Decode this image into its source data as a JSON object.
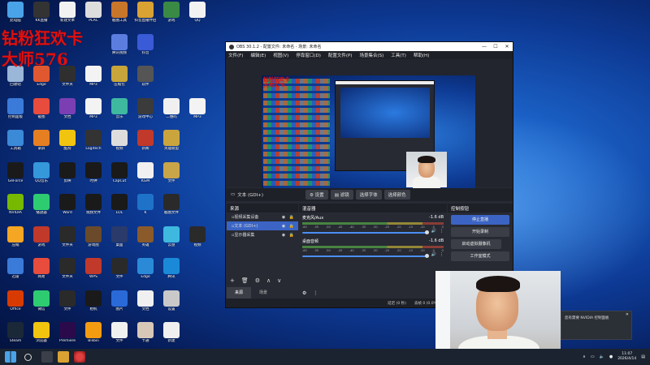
{
  "desktop": {
    "overlay_line1": "钻粉狂欢卡",
    "overlay_line2": "大师576",
    "icons": [
      {
        "label": "此电脑",
        "color": "#4aa3e8",
        "col": 0,
        "row": 0
      },
      {
        "label": "KK直播",
        "color": "#333",
        "col": 1,
        "row": 0
      },
      {
        "label": "新建文本",
        "color": "#f2f2f2",
        "col": 2,
        "row": 0
      },
      {
        "label": "PLAC",
        "color": "#ddd",
        "col": 3,
        "row": 0
      },
      {
        "label": "截图工具",
        "color": "#c8762a",
        "col": 4,
        "row": 0
      },
      {
        "label": "抖音直播伴侣",
        "color": "#d9a232",
        "col": 5,
        "row": 0
      },
      {
        "label": "游戏",
        "color": "#3a8a45",
        "col": 6,
        "row": 0
      },
      {
        "label": "QQ",
        "color": "#f2f2f2",
        "col": 7,
        "row": 0
      },
      {
        "label": "腾讯视频",
        "color": "#5c7de0",
        "col": 4,
        "row": 1
      },
      {
        "label": "抖音",
        "color": "#3a5ad8",
        "col": 5,
        "row": 1
      },
      {
        "label": "压缩包",
        "color": "#c7a53a",
        "col": 4,
        "row": 2
      },
      {
        "label": "软件",
        "color": "#555",
        "col": 5,
        "row": 2
      },
      {
        "label": "回收站",
        "color": "#9ab6d8",
        "col": 0,
        "row": 2
      },
      {
        "label": "Edge",
        "color": "#e05830",
        "col": 1,
        "row": 2
      },
      {
        "label": "文件夹",
        "color": "#2f2f2f",
        "col": 2,
        "row": 2
      },
      {
        "label": "MP3",
        "color": "#f3f3f3",
        "col": 3,
        "row": 2
      },
      {
        "label": "音乐",
        "color": "#3fb8a0",
        "col": 4,
        "row": 3
      },
      {
        "label": "游戏中心",
        "color": "#3b3b3b",
        "col": 5,
        "row": 3
      },
      {
        "label": "二维码",
        "color": "#f0f0f0",
        "col": 6,
        "row": 3
      },
      {
        "label": "MP3",
        "color": "#f3f3f3",
        "col": 7,
        "row": 3
      },
      {
        "label": "控制面板",
        "color": "#3a7ad8",
        "col": 0,
        "row": 3
      },
      {
        "label": "截图",
        "color": "#e74c3c",
        "col": 1,
        "row": 3
      },
      {
        "label": "文档",
        "color": "#7b3fb3",
        "col": 2,
        "row": 3
      },
      {
        "label": "MP3",
        "color": "#f3f3f3",
        "col": 3,
        "row": 3
      },
      {
        "label": "工具箱",
        "color": "#3a8ad8",
        "col": 0,
        "row": 4
      },
      {
        "label": "录屏",
        "color": "#e67e22",
        "col": 1,
        "row": 4
      },
      {
        "label": "酷狗",
        "color": "#f1c40f",
        "col": 2,
        "row": 4
      },
      {
        "label": "Logitech",
        "color": "#333",
        "col": 3,
        "row": 4
      },
      {
        "label": "视频",
        "color": "#ddd",
        "col": 4,
        "row": 4
      },
      {
        "label": "新闻",
        "color": "#c0392b",
        "col": 5,
        "row": 4
      },
      {
        "label": "英雄联盟",
        "color": "#caa53d",
        "col": 6,
        "row": 4
      },
      {
        "label": "GeForce",
        "color": "#1a1a1a",
        "col": 0,
        "row": 5
      },
      {
        "label": "QQ音乐",
        "color": "#3498db",
        "col": 1,
        "row": 5
      },
      {
        "label": "剪映",
        "color": "#1a1a1a",
        "col": 2,
        "row": 5
      },
      {
        "label": "时钟",
        "color": "#1a1a1a",
        "col": 3,
        "row": 5
      },
      {
        "label": "CapCut",
        "color": "#1a1a1a",
        "col": 4,
        "row": 5
      },
      {
        "label": "KGM",
        "color": "#f0f0f0",
        "col": 5,
        "row": 5
      },
      {
        "label": "文件",
        "color": "#c9a54a",
        "col": 6,
        "row": 5
      },
      {
        "label": "NVIDIA",
        "color": "#76b900",
        "col": 0,
        "row": 6
      },
      {
        "label": "播放器",
        "color": "#2ecc71",
        "col": 1,
        "row": 6
      },
      {
        "label": "Word",
        "color": "#1a1a1a",
        "col": 2,
        "row": 6
      },
      {
        "label": "视频文件",
        "color": "#1a1a1a",
        "col": 3,
        "row": 6
      },
      {
        "label": "LOL",
        "color": "#1a1a1a",
        "col": 4,
        "row": 6
      },
      {
        "label": "K",
        "color": "#1e73c8",
        "col": 5,
        "row": 6
      },
      {
        "label": "截图文件",
        "color": "#2a2a2a",
        "col": 6,
        "row": 6
      },
      {
        "label": "压缩",
        "color": "#f5a623",
        "col": 0,
        "row": 7
      },
      {
        "label": "游戏",
        "color": "#c0392b",
        "col": 1,
        "row": 7
      },
      {
        "label": "文件夹",
        "color": "#2a2a2a",
        "col": 2,
        "row": 7
      },
      {
        "label": "游戏图",
        "color": "#6a4a2a",
        "col": 3,
        "row": 7
      },
      {
        "label": "桌面",
        "color": "#2a3a6a",
        "col": 4,
        "row": 7
      },
      {
        "label": "英雄",
        "color": "#8a5a2a",
        "col": 5,
        "row": 7
      },
      {
        "label": "云盘",
        "color": "#3fb8e0",
        "col": 6,
        "row": 7
      },
      {
        "label": "视频",
        "color": "#2a2a2a",
        "col": 7,
        "row": 7
      },
      {
        "label": "迅雷",
        "color": "#3a7ad8",
        "col": 0,
        "row": 8
      },
      {
        "label": "网易",
        "color": "#e74c3c",
        "col": 1,
        "row": 8
      },
      {
        "label": "文件夹",
        "color": "#2a2a2a",
        "col": 2,
        "row": 8
      },
      {
        "label": "WPS",
        "color": "#c0392b",
        "col": 3,
        "row": 8
      },
      {
        "label": "文件",
        "color": "#2a2a2a",
        "col": 4,
        "row": 8
      },
      {
        "label": "Edge",
        "color": "#2a8ad8",
        "col": 5,
        "row": 8
      },
      {
        "label": "腾讯",
        "color": "#1a8ad8",
        "col": 6,
        "row": 8
      },
      {
        "label": "Office",
        "color": "#d83b01",
        "col": 0,
        "row": 9
      },
      {
        "label": "微信",
        "color": "#2ecc71",
        "col": 1,
        "row": 9
      },
      {
        "label": "文件",
        "color": "#2a2a2a",
        "col": 2,
        "row": 9
      },
      {
        "label": "相机",
        "color": "#1a1a1a",
        "col": 3,
        "row": 9
      },
      {
        "label": "图片",
        "color": "#2a6ad8",
        "col": 4,
        "row": 9
      },
      {
        "label": "文档",
        "color": "#f0f0f0",
        "col": 5,
        "row": 9
      },
      {
        "label": "设置",
        "color": "#c9c9c9",
        "col": 6,
        "row": 9
      },
      {
        "label": "Steam",
        "color": "#1b2838",
        "col": 0,
        "row": 10
      },
      {
        "label": "浏览器",
        "color": "#f1c40f",
        "col": 1,
        "row": 10
      },
      {
        "label": "Premiere",
        "color": "#2a0a4a",
        "col": 2,
        "row": 10
      },
      {
        "label": "Bilibili",
        "color": "#f39c12",
        "col": 3,
        "row": 10
      },
      {
        "label": "文件",
        "color": "#f0f0f0",
        "col": 4,
        "row": 10
      },
      {
        "label": "卡通",
        "color": "#d8c8b8",
        "col": 5,
        "row": 10
      },
      {
        "label": "新建",
        "color": "#f0f0f0",
        "col": 6,
        "row": 10
      }
    ]
  },
  "obs": {
    "title": "OBS 30.1.2 - 配置文件: 未命名 - 场景: 未命名",
    "menu": [
      "文件(F)",
      "编辑(E)",
      "视图(V)",
      "停靠窗口(D)",
      "配置文件(P)",
      "场景集合(S)",
      "工具(T)",
      "帮助(H)"
    ],
    "source_name": "文本 (GDI+)",
    "toolbar": {
      "settings": "设置",
      "filters": "滤镜",
      "font": "选择字体",
      "color": "选择颜色"
    },
    "sources": {
      "header": "来源",
      "items": [
        {
          "label": "视频采集设备",
          "active": false
        },
        {
          "label": "文本 (GDI+)",
          "active": true
        },
        {
          "label": "显示器采集",
          "active": false
        }
      ]
    },
    "mixer": {
      "header": "混音器",
      "channels": [
        {
          "name": "麦克风/Aux",
          "db": "-1.6 dB"
        },
        {
          "name": "桌面音频",
          "db": "-1.6 dB"
        }
      ],
      "scale": [
        "-60",
        "-55",
        "-50",
        "-45",
        "-40",
        "-35",
        "-30",
        "-25",
        "-20",
        "-15",
        "-10",
        "-5",
        "0"
      ]
    },
    "controls": {
      "header": "控制按钮",
      "start_stream": "停止直播",
      "start_record": "开始录制",
      "virtual_cam": "启动虚拟摄像机",
      "studio_mode": "工作室模式"
    },
    "bottom_tabs": {
      "sources": "来源",
      "scenes": "场景"
    },
    "status": {
      "delay": "延迟 (0 秒)",
      "dropped": "丢帧 0 (0.0%)",
      "kbps": "0 kbps",
      "rec_time": "00:00:04",
      "stream_time": "00:00:00"
    }
  },
  "preview_overlay": {
    "line1": "钻粉狂欢卡",
    "line2": "大师576"
  },
  "notification": {
    "text": "您有需要 NVIDIA 控制面板"
  },
  "taskbar": {
    "time": "11:07",
    "date": "2026/4/14"
  }
}
